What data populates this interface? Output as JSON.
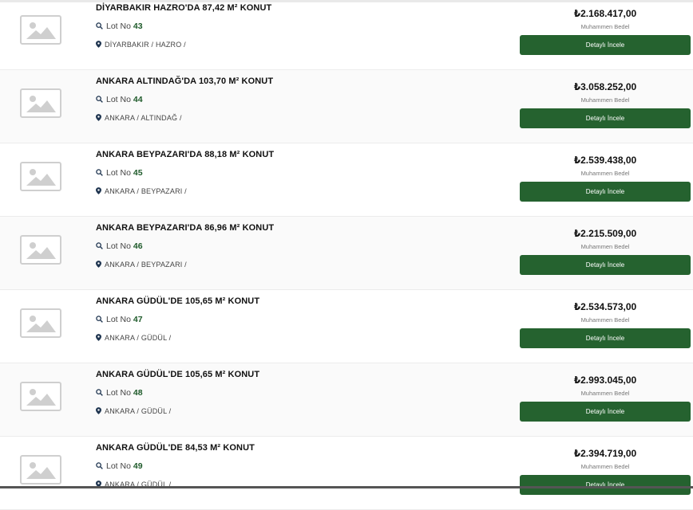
{
  "listings": [
    {
      "title": "DİYARBAKIR HAZRO'DA 87,42 M² KONUT",
      "lot_label": "Lot No",
      "lot": "43",
      "location": "DİYARBAKIR / HAZRO /",
      "price": "₺2.168.417,00",
      "price_label": "Muhammen Bedel",
      "button": "Detaylı İncele"
    },
    {
      "title": "ANKARA ALTINDAĞ'DA 103,70 M² KONUT",
      "lot_label": "Lot No",
      "lot": "44",
      "location": "ANKARA / ALTINDAĞ /",
      "price": "₺3.058.252,00",
      "price_label": "Muhammen Bedel",
      "button": "Detaylı İncele"
    },
    {
      "title": "ANKARA BEYPAZARI'DA 88,18 M² KONUT",
      "lot_label": "Lot No",
      "lot": "45",
      "location": "ANKARA / BEYPAZARI /",
      "price": "₺2.539.438,00",
      "price_label": "Muhammen Bedel",
      "button": "Detaylı İncele"
    },
    {
      "title": "ANKARA BEYPAZARI'DA 86,96 M² KONUT",
      "lot_label": "Lot No",
      "lot": "46",
      "location": "ANKARA / BEYPAZARI /",
      "price": "₺2.215.509,00",
      "price_label": "Muhammen Bedel",
      "button": "Detaylı İncele"
    },
    {
      "title": "ANKARA GÜDÜL'DE 105,65 M² KONUT",
      "lot_label": "Lot No",
      "lot": "47",
      "location": "ANKARA / GÜDÜL /",
      "price": "₺2.534.573,00",
      "price_label": "Muhammen Bedel",
      "button": "Detaylı İncele"
    },
    {
      "title": "ANKARA GÜDÜL'DE 105,65 M² KONUT",
      "lot_label": "Lot No",
      "lot": "48",
      "location": "ANKARA / GÜDÜL /",
      "price": "₺2.993.045,00",
      "price_label": "Muhammen Bedel",
      "button": "Detaylı İncele"
    },
    {
      "title": "ANKARA GÜDÜL'DE 84,53 M² KONUT",
      "lot_label": "Lot No",
      "lot": "49",
      "location": "ANKARA / GÜDÜL /",
      "price": "₺2.394.719,00",
      "price_label": "Muhammen Bedel",
      "button": "Detaylı İncele"
    }
  ],
  "icons": {
    "thumbnail": "image-placeholder-icon",
    "lot": "search-icon",
    "location": "map-pin-icon"
  },
  "colors": {
    "button_bg": "#25622f",
    "lot_number": "#1e5a2a",
    "location_pin": "#1f3550"
  }
}
